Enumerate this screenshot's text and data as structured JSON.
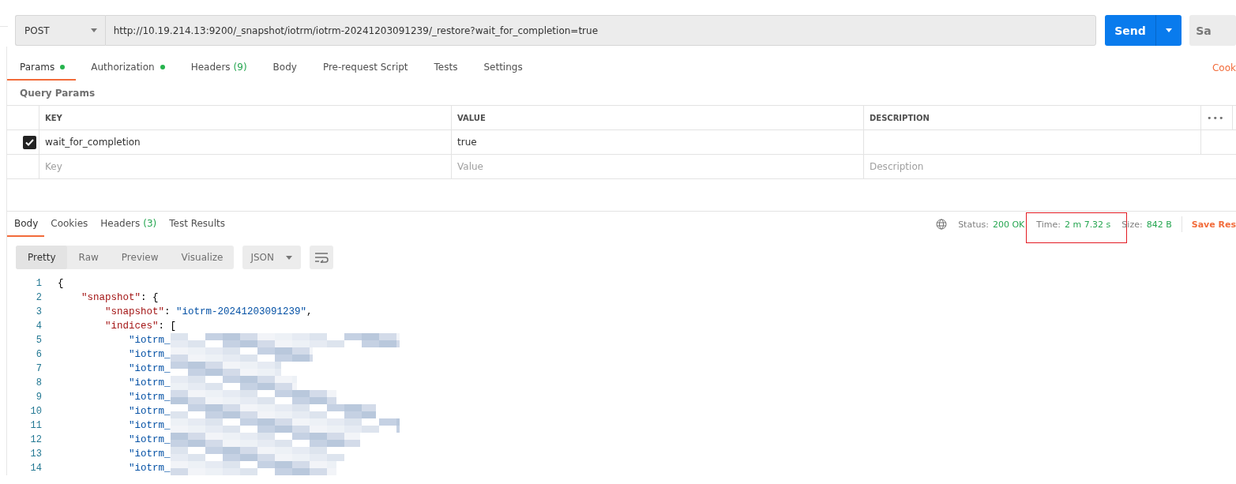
{
  "request": {
    "method": "POST",
    "url": "http://10.19.214.13:9200/_snapshot/iotrm/iotrm-20241203091239/_restore?wait_for_completion=true",
    "send_label": "Send",
    "save_label": "Sa"
  },
  "request_tabs": [
    {
      "label": "Params",
      "selected": true,
      "dot": true
    },
    {
      "label": "Authorization",
      "selected": false,
      "dot": true
    },
    {
      "label": "Headers",
      "count": "(9)",
      "selected": false,
      "dot": false
    },
    {
      "label": "Body",
      "selected": false,
      "dot": false
    },
    {
      "label": "Pre-request Script",
      "selected": false,
      "dot": false
    },
    {
      "label": "Tests",
      "selected": false,
      "dot": false
    },
    {
      "label": "Settings",
      "selected": false,
      "dot": false
    }
  ],
  "cookies_link": "Cook",
  "query_params": {
    "title": "Query Params",
    "columns": [
      "KEY",
      "VALUE",
      "DESCRIPTION"
    ],
    "more": "•••",
    "rows": [
      {
        "checked": true,
        "key": "wait_for_completion",
        "value": "true"
      }
    ],
    "new_row": [
      {
        "placeholder": "Key"
      },
      {
        "placeholder": "Value"
      },
      {
        "placeholder": "Description"
      }
    ]
  },
  "response_tabs": [
    {
      "label": "Body",
      "selected": true
    },
    {
      "label": "Cookies",
      "selected": false
    },
    {
      "label": "Headers",
      "count": "(3)",
      "selected": false
    },
    {
      "label": "Test Results",
      "selected": false
    }
  ],
  "status": [
    {
      "label": "Status:",
      "value": "200 OK"
    },
    {
      "label": "Time:",
      "value": "2 m 7.32 s",
      "highlighted": true
    },
    {
      "label": "Size:",
      "value": "842 B"
    }
  ],
  "save_response": "Save Res",
  "view_modes": [
    {
      "label": "Pretty",
      "selected": true
    },
    {
      "label": "Raw",
      "selected": false
    },
    {
      "label": "Preview",
      "selected": false
    },
    {
      "label": "Visualize",
      "selected": false
    }
  ],
  "format": "JSON",
  "code_lines": [
    {
      "number": "1",
      "tokens": [
        {
          "kind": "punct",
          "text": "{"
        }
      ]
    },
    {
      "number": "2",
      "tokens": [
        {
          "kind": "key",
          "text": "    \"snapshot\""
        },
        {
          "kind": "punct",
          "text": ": {"
        }
      ]
    },
    {
      "number": "3",
      "tokens": [
        {
          "kind": "key",
          "text": "        \"snapshot\""
        },
        {
          "kind": "punct",
          "text": ": "
        },
        {
          "kind": "string",
          "text": "\"iotrm-20241203091239\""
        },
        {
          "kind": "punct",
          "text": ","
        }
      ]
    },
    {
      "number": "4",
      "tokens": [
        {
          "kind": "key",
          "text": "        \"indices\""
        },
        {
          "kind": "punct",
          "text": ": ["
        }
      ]
    },
    {
      "number": "5",
      "tokens": [
        {
          "kind": "string",
          "text": "            \"iotrm_"
        }
      ],
      "redacted": true
    },
    {
      "number": "6",
      "tokens": [
        {
          "kind": "string",
          "text": "            \"iotrm_"
        }
      ],
      "redacted": true
    },
    {
      "number": "7",
      "tokens": [
        {
          "kind": "string",
          "text": "            \"iotrm_"
        }
      ],
      "redacted": true
    },
    {
      "number": "8",
      "tokens": [
        {
          "kind": "string",
          "text": "            \"iotrm_"
        }
      ],
      "redacted": true
    },
    {
      "number": "9",
      "tokens": [
        {
          "kind": "string",
          "text": "            \"iotrm_"
        }
      ],
      "redacted": true
    },
    {
      "number": "10",
      "tokens": [
        {
          "kind": "string",
          "text": "            \"iotrm_"
        }
      ],
      "redacted": true
    },
    {
      "number": "11",
      "tokens": [
        {
          "kind": "string",
          "text": "            \"iotrm_"
        }
      ],
      "redacted": true
    },
    {
      "number": "12",
      "tokens": [
        {
          "kind": "string",
          "text": "            \"iotrm_"
        }
      ],
      "redacted": true
    },
    {
      "number": "13",
      "tokens": [
        {
          "kind": "string",
          "text": "            \"iotrm_"
        }
      ],
      "redacted": true
    },
    {
      "number": "14",
      "tokens": [
        {
          "kind": "string",
          "text": "            \"iotrm_"
        }
      ],
      "redacted": true
    }
  ]
}
